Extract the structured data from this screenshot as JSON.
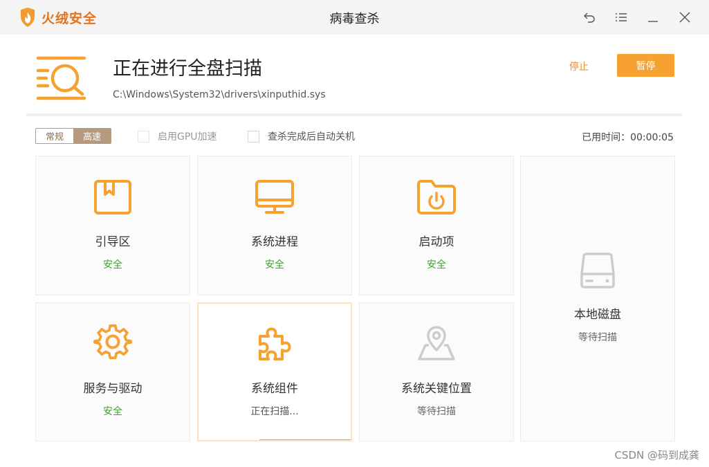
{
  "app": {
    "brand": "火绒安全",
    "window_title": "病毒查杀"
  },
  "window_controls": {
    "back": "back-icon",
    "menu": "menu-icon",
    "minimize": "minimize-icon",
    "close": "close-icon"
  },
  "scan": {
    "title": "正在进行全盘扫描",
    "current_path": "C:\\Windows\\System32\\drivers\\xinputhid.sys",
    "stop_label": "停止",
    "pause_label": "暂停"
  },
  "options": {
    "mode_normal": "常规",
    "mode_fast": "高速",
    "selected_mode": "高速",
    "gpu_label": "启用GPU加速",
    "gpu_checked": false,
    "gpu_enabled": false,
    "shutdown_label": "查杀完成后自动关机",
    "shutdown_checked": false,
    "elapsed_label": "已用时间：",
    "elapsed_value": "00:00:05"
  },
  "cards": [
    {
      "name": "引导区",
      "status": "安全",
      "icon": "boot-sector-icon",
      "state": "safe"
    },
    {
      "name": "系统进程",
      "status": "安全",
      "icon": "monitor-icon",
      "state": "safe"
    },
    {
      "name": "启动项",
      "status": "安全",
      "icon": "startup-folder-icon",
      "state": "safe"
    },
    {
      "name": "本地磁盘",
      "status": "等待扫描",
      "icon": "disk-icon",
      "state": "waiting"
    },
    {
      "name": "服务与驱动",
      "status": "安全",
      "icon": "gear-icon",
      "state": "safe"
    },
    {
      "name": "系统组件",
      "status": "正在扫描...",
      "icon": "puzzle-icon",
      "state": "scanning"
    },
    {
      "name": "系统关键位置",
      "status": "等待扫描",
      "icon": "location-icon",
      "state": "waiting"
    }
  ],
  "colors": {
    "accent": "#f7a130",
    "brand": "#e8711c",
    "safe": "#3ea22d",
    "inactive_icon": "#cccccc",
    "toggle": "#b59a80"
  },
  "watermark": "CSDN @码到成龚"
}
